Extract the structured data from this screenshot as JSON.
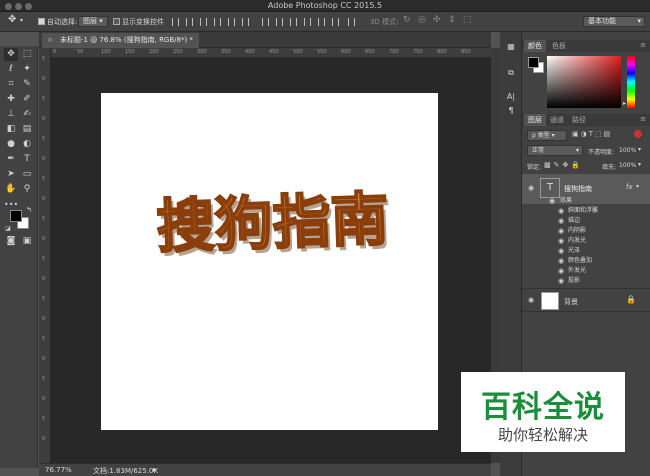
{
  "titlebar": {
    "title": "Adobe Photoshop CC 2015.5"
  },
  "options": {
    "auto_select_label": "自动选择:",
    "auto_select_value": "图层",
    "show_transform_label": "显示变换控件",
    "mode_3d_label": "3D 模式:",
    "workspace": "基本功能"
  },
  "document": {
    "tab_title": "未标题-1 @ 76.8% (搜狗指南, RGB/8*) *",
    "zoom": "76.77%",
    "doc_info": "文档:1.83M/625.0K",
    "art_text": "搜狗指南",
    "ruler_top": [
      "0",
      "50",
      "100",
      "150",
      "200",
      "250",
      "300",
      "350",
      "400",
      "450",
      "500",
      "550",
      "600",
      "650",
      "700",
      "750",
      "800",
      "850"
    ],
    "ruler_left": [
      "5",
      "0",
      "5",
      "0",
      "5",
      "0",
      "5",
      "0",
      "5",
      "0",
      "5",
      "0",
      "5",
      "0",
      "5",
      "0",
      "5",
      "0",
      "5",
      "0"
    ]
  },
  "panels": {
    "color_tabs": [
      "颜色",
      "色板"
    ],
    "layer_tabs": [
      "图层",
      "通道",
      "路径"
    ],
    "kind_label": "ρ 类型",
    "blend_mode": "正常",
    "opacity_label": "不透明度:",
    "opacity_value": "100%",
    "lock_label": "锁定:",
    "fill_label": "填充:",
    "fill_value": "100%",
    "text_layer_name": "搜狗指南",
    "fx_label": "fx",
    "effects_label": "效果",
    "effects": [
      "斜面和浮雕",
      "描边",
      "内阴影",
      "内发光",
      "光泽",
      "颜色叠加",
      "外发光",
      "投影"
    ],
    "bg_layer_name": "背景"
  },
  "watermark": {
    "title": "百科全说",
    "subtitle": "助你轻松解决"
  },
  "colors": {
    "accent_orange": "#e07a2a",
    "foreground": "#000000",
    "background": "#ffffff",
    "watermark_green": "#1a8e3a"
  }
}
